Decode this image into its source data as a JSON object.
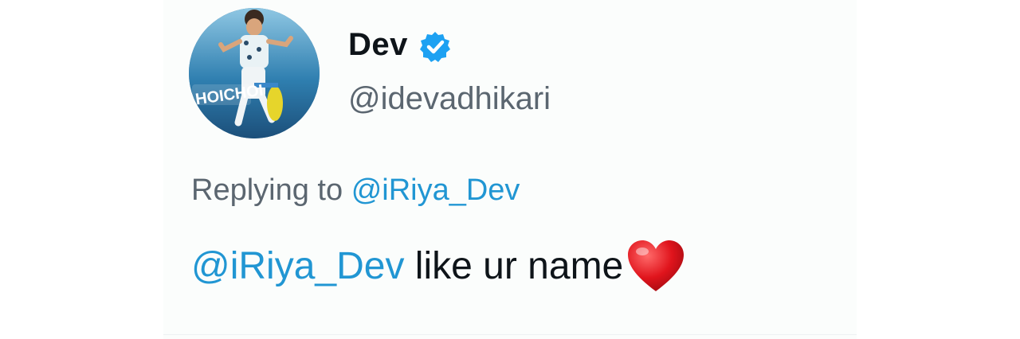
{
  "tweet": {
    "author": {
      "display_name": "Dev",
      "handle": "@idevadhikari",
      "verified": true,
      "avatar_text": "HOICHOI"
    },
    "reply": {
      "prefix": "Replying to",
      "to_handle": "@iRiya_Dev"
    },
    "body": {
      "mention": "@iRiya_Dev",
      "text": " like ur name",
      "emoji": "heart-emoji"
    }
  },
  "colors": {
    "link": "#2196d3",
    "verified": "#1da1f2",
    "text": "#0e1419",
    "secondary": "#5b6670",
    "heart": "#d6121b"
  }
}
